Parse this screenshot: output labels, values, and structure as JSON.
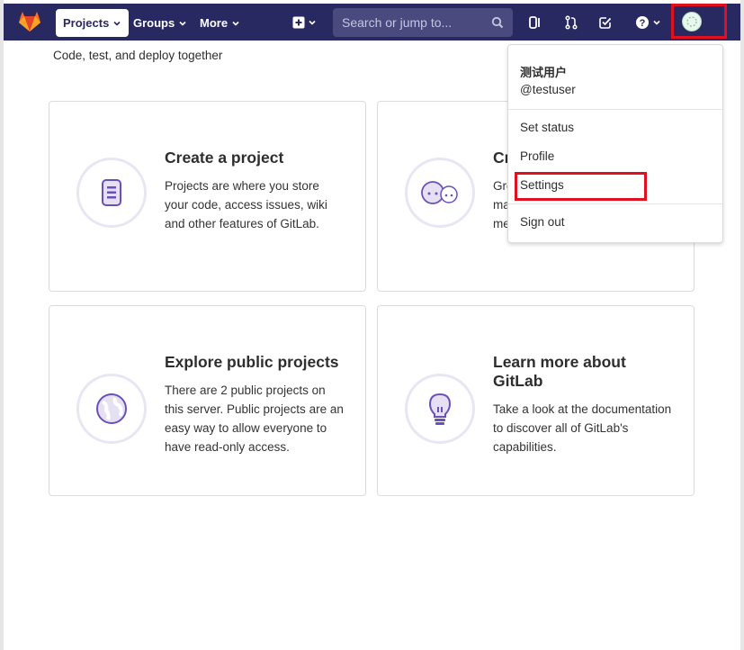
{
  "navbar": {
    "projects_label": "Projects",
    "groups_label": "Groups",
    "more_label": "More",
    "search_placeholder": "Search or jump to...",
    "accent_color": "#292961"
  },
  "main": {
    "tagline": "Code, test, and deploy together",
    "cards": [
      {
        "title": "Create a project",
        "text": "Projects are where you store your code, access issues, wiki and other features of GitLab.",
        "icon": "project-icon"
      },
      {
        "title": "Cr",
        "text_lines": [
          "Gro",
          "ma",
          "me"
        ],
        "icon": "group-icon"
      },
      {
        "title": "Explore public projects",
        "text": "There are 2 public projects on this server. Public projects are an easy way to allow everyone to have read-only access.",
        "icon": "globe-icon"
      },
      {
        "title": "Learn more about GitLab",
        "text": "Take a look at the documentation to discover all of GitLab's capabilities.",
        "icon": "lightbulb-icon"
      }
    ]
  },
  "user_menu": {
    "display_name": "测试用户",
    "username": "@testuser",
    "items": [
      "Set status",
      "Profile",
      "Settings",
      "Sign out"
    ],
    "highlight_color": "#e0101e"
  }
}
